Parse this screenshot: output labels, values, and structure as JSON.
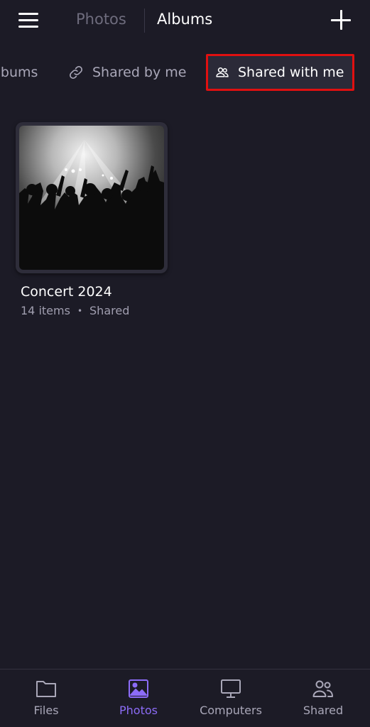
{
  "header": {
    "tab_photos": "Photos",
    "tab_albums": "Albums"
  },
  "filters": {
    "all_albums": "albums",
    "shared_by_me": "Shared by me",
    "shared_with_me": "Shared with me"
  },
  "albums": [
    {
      "title": "Concert 2024",
      "items": "14 items",
      "dot": "•",
      "status": "Shared"
    }
  ],
  "bottom_nav": {
    "items": [
      {
        "label": "Files",
        "icon": "folder-icon"
      },
      {
        "label": "Photos",
        "icon": "image-icon",
        "active": true
      },
      {
        "label": "Computers",
        "icon": "monitor-icon"
      },
      {
        "label": "Shared",
        "icon": "people-icon"
      }
    ]
  },
  "colors": {
    "background": "#1c1b26",
    "accent": "#8c6cf7",
    "highlight_border": "#e01010"
  }
}
